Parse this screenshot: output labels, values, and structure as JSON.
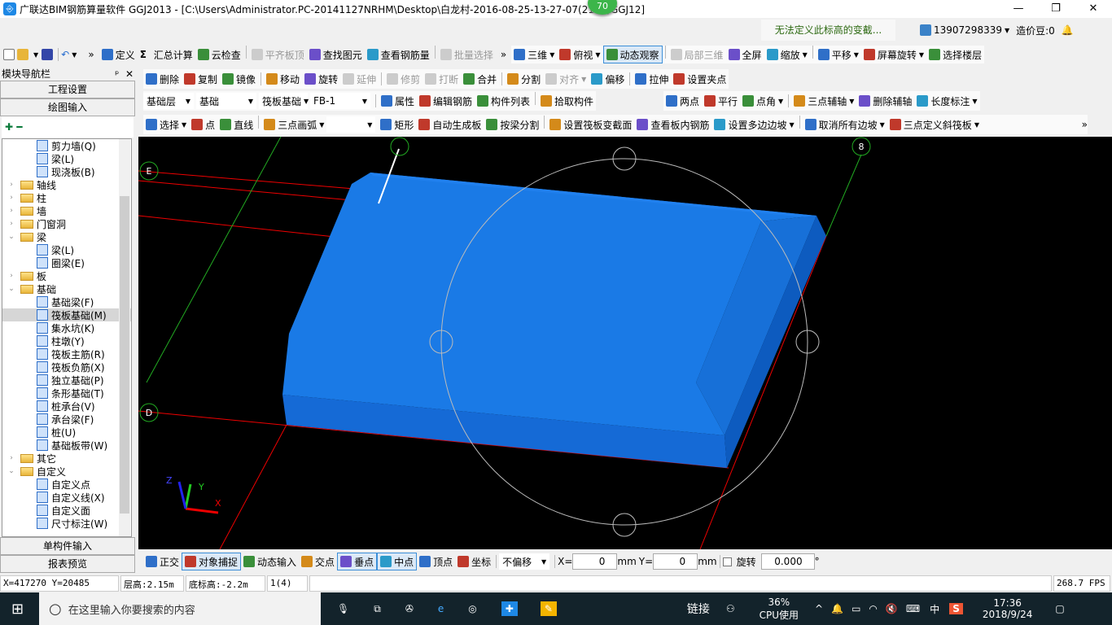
{
  "title": "广联达BIM钢筋算量软件 GGJ2013 - [C:\\Users\\Administrator.PC-20141127NRHM\\Desktop\\白龙村-2016-08-25-13-27-07(2168)GGJ12]",
  "badge": "70",
  "window_buttons": [
    "—",
    "❐",
    "✕"
  ],
  "notice": "无法定义此标高的变截...",
  "user": {
    "phone": "13907298339",
    "beans": "造价豆:0"
  },
  "toolbar1": [
    {
      "label": "定义"
    },
    {
      "label": "汇总计算",
      "icon": "Σ"
    },
    {
      "label": "云检查"
    },
    {
      "label": "平齐板顶",
      "disabled": true
    },
    {
      "label": "查找图元"
    },
    {
      "label": "查看钢筋量"
    },
    {
      "label": "批量选择",
      "disabled": true
    }
  ],
  "toolbar1b": [
    {
      "label": "三维",
      "dd": true
    },
    {
      "label": "俯视",
      "dd": true
    },
    {
      "label": "动态观察",
      "active": true
    },
    {
      "label": "局部三维",
      "disabled": true
    },
    {
      "label": "全屏"
    },
    {
      "label": "缩放",
      "dd": true
    },
    {
      "label": "平移",
      "dd": true
    },
    {
      "label": "屏幕旋转",
      "dd": true
    },
    {
      "label": "选择楼层"
    }
  ],
  "toolbar2": [
    {
      "label": "删除"
    },
    {
      "label": "复制"
    },
    {
      "label": "镜像"
    },
    {
      "label": "移动"
    },
    {
      "label": "旋转"
    },
    {
      "label": "延伸",
      "disabled": true
    },
    {
      "label": "修剪",
      "disabled": true
    },
    {
      "label": "打断",
      "disabled": true
    },
    {
      "label": "合并"
    },
    {
      "label": "分割"
    },
    {
      "label": "对齐",
      "disabled": true,
      "dd": true
    },
    {
      "label": "偏移"
    },
    {
      "label": "拉伸"
    },
    {
      "label": "设置夹点"
    }
  ],
  "combos": [
    "基础层",
    "基础",
    "筏板基础",
    "FB-1"
  ],
  "toolbar3": [
    {
      "label": "属性"
    },
    {
      "label": "编辑钢筋"
    },
    {
      "label": "构件列表"
    },
    {
      "label": "拾取构件"
    }
  ],
  "toolbar3b": [
    {
      "label": "两点"
    },
    {
      "label": "平行"
    },
    {
      "label": "点角",
      "dd": true
    },
    {
      "label": "三点辅轴",
      "dd": true
    },
    {
      "label": "删除辅轴"
    },
    {
      "label": "长度标注",
      "dd": true
    }
  ],
  "toolbar4": [
    {
      "label": "选择",
      "dd": true
    },
    {
      "label": "点"
    },
    {
      "label": "直线"
    },
    {
      "label": "三点画弧",
      "dd": true
    }
  ],
  "toolbar4b": [
    {
      "label": "矩形"
    },
    {
      "label": "自动生成板"
    },
    {
      "label": "按梁分割"
    },
    {
      "label": "设置筏板变截面"
    },
    {
      "label": "查看板内钢筋"
    },
    {
      "label": "设置多边边坡",
      "dd": true
    },
    {
      "label": "取消所有边坡",
      "dd": true
    },
    {
      "label": "三点定义斜筏板",
      "dd": true
    }
  ],
  "nav": {
    "title": "模块导航栏",
    "pin": "ᵖ",
    "close": "✕",
    "top_buttons": [
      "工程设置",
      "绘图输入"
    ],
    "bottom_buttons": [
      "单构件输入",
      "报表预览"
    ],
    "tree": [
      {
        "label": "剪力墙(Q)",
        "level": 2
      },
      {
        "label": "梁(L)",
        "level": 2
      },
      {
        "label": "现浇板(B)",
        "level": 2
      },
      {
        "label": "轴线",
        "level": 1,
        "state": "collapsed"
      },
      {
        "label": "柱",
        "level": 1,
        "state": "collapsed"
      },
      {
        "label": "墙",
        "level": 1,
        "state": "collapsed"
      },
      {
        "label": "门窗洞",
        "level": 1,
        "state": "collapsed"
      },
      {
        "label": "梁",
        "level": 1,
        "state": "expanded"
      },
      {
        "label": "梁(L)",
        "level": 2
      },
      {
        "label": "圈梁(E)",
        "level": 2
      },
      {
        "label": "板",
        "level": 1,
        "state": "collapsed"
      },
      {
        "label": "基础",
        "level": 1,
        "state": "expanded"
      },
      {
        "label": "基础梁(F)",
        "level": 2
      },
      {
        "label": "筏板基础(M)",
        "level": 2,
        "selected": true
      },
      {
        "label": "集水坑(K)",
        "level": 2
      },
      {
        "label": "柱墩(Y)",
        "level": 2
      },
      {
        "label": "筏板主筋(R)",
        "level": 2
      },
      {
        "label": "筏板负筋(X)",
        "level": 2
      },
      {
        "label": "独立基础(P)",
        "level": 2
      },
      {
        "label": "条形基础(T)",
        "level": 2
      },
      {
        "label": "桩承台(V)",
        "level": 2
      },
      {
        "label": "承台梁(F)",
        "level": 2
      },
      {
        "label": "桩(U)",
        "level": 2
      },
      {
        "label": "基础板带(W)",
        "level": 2
      },
      {
        "label": "其它",
        "level": 1,
        "state": "collapsed"
      },
      {
        "label": "自定义",
        "level": 1,
        "state": "expanded"
      },
      {
        "label": "自定义点",
        "level": 2
      },
      {
        "label": "自定义线(X)",
        "level": 2
      },
      {
        "label": "自定义面",
        "level": 2
      },
      {
        "label": "尺寸标注(W)",
        "level": 2
      }
    ]
  },
  "viewport": {
    "axis_labels": [
      "E",
      "D",
      "8"
    ],
    "axes": {
      "x": "X",
      "y": "Y",
      "z": "Z"
    },
    "slab_color": "#1a7ae6"
  },
  "snapbar": {
    "items": [
      {
        "label": "正交"
      },
      {
        "label": "对象捕捉",
        "active": true
      },
      {
        "label": "动态输入"
      },
      {
        "label": "交点"
      },
      {
        "label": "垂点",
        "active": true
      },
      {
        "label": "中点",
        "active": true
      },
      {
        "label": "顶点"
      },
      {
        "label": "坐标"
      }
    ],
    "offset_mode": "不偏移",
    "x_label": "X=",
    "x_value": "0",
    "unit": "mm",
    "y_label": "Y=",
    "y_value": "0",
    "rotate_label": "旋转",
    "rotate_value": "0.000",
    "degree": "°"
  },
  "status": {
    "coords": "X=417270 Y=20485",
    "floor_height": "层高:2.15m",
    "base_elev": "底标高:-2.2m",
    "count": "1(4)",
    "fps": "268.7 FPS"
  },
  "taskbar": {
    "search_placeholder": "在这里输入你要搜索的内容",
    "link": "链接",
    "cpu_percent": "36%",
    "cpu_label": "CPU使用",
    "ime": "中",
    "time": "17:36",
    "date": "2018/9/24"
  }
}
